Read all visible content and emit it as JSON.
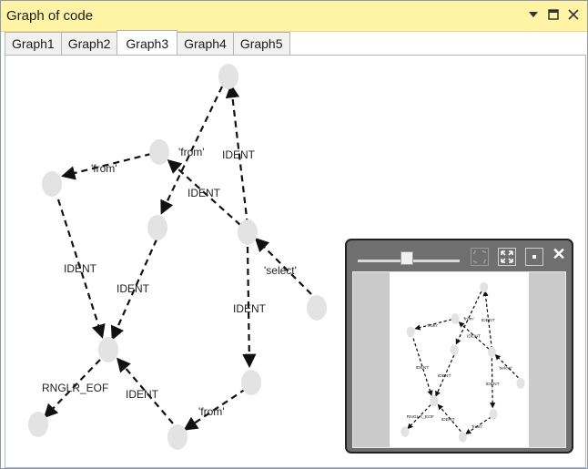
{
  "window": {
    "title": "Graph of code",
    "controls": [
      "dropdown-icon",
      "maximize-icon",
      "close-icon"
    ]
  },
  "tabs": [
    {
      "label": "Graph1",
      "active": false
    },
    {
      "label": "Graph2",
      "active": false
    },
    {
      "label": "Graph3",
      "active": true
    },
    {
      "label": "Graph4",
      "active": false
    },
    {
      "label": "Graph5",
      "active": false
    }
  ],
  "graph": {
    "node_color": "#e3e3e3",
    "edge_color": "#111111",
    "edge_labels": {
      "e1": "IDENT",
      "e2": "'from'",
      "e3": "IDENT",
      "e4": "'from'",
      "e5": "IDENT",
      "e6": "'select'",
      "e7": "IDENT",
      "e8": "IDENT",
      "e9": "IDENT",
      "e10": "RNGLR_EOF",
      "e11": "'from'",
      "e12": "IDENT"
    }
  },
  "minimap": {
    "zoom_level_percent": 45,
    "buttons": [
      "fit-to-screen-icon",
      "fullscreen-icon",
      "pin-icon",
      "close-icon"
    ]
  }
}
